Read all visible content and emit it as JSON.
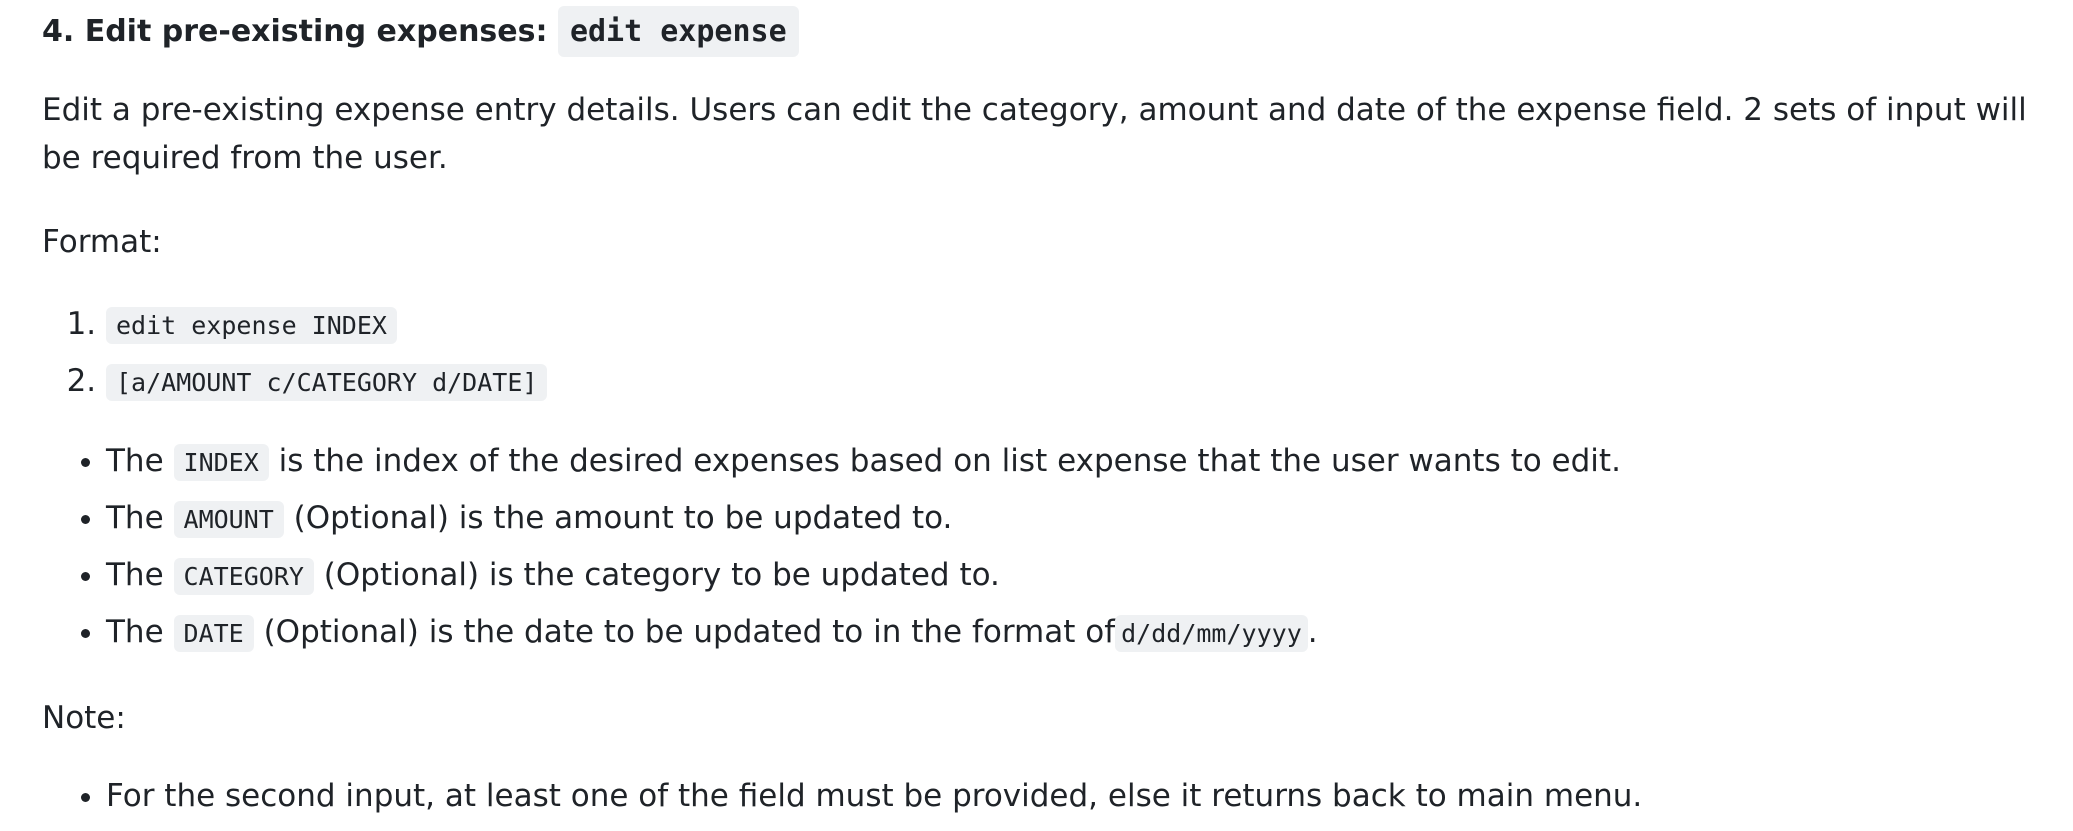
{
  "heading": {
    "prefix": "4. Edit pre-existing expenses: ",
    "command": "edit expense"
  },
  "description": "Edit a pre-existing expense entry details. Users can edit the category, amount and date of the expense field. 2 sets of input will be required from the user.",
  "format_label": "Format:",
  "format_steps": [
    "edit expense INDEX",
    "[a/AMOUNT c/CATEGORY d/DATE]"
  ],
  "params": [
    {
      "pre": "The ",
      "code": "INDEX",
      "post": " is the index of the desired expenses based on list expense that the user wants to edit."
    },
    {
      "pre": "The ",
      "code": "AMOUNT",
      "post": " (Optional) is the amount to be updated to."
    },
    {
      "pre": "The ",
      "code": "CATEGORY",
      "post": " (Optional) is the category to be updated to."
    },
    {
      "pre": "The ",
      "code": "DATE",
      "post": " (Optional) is the date to be updated to in the format of",
      "code2": "d/dd/mm/yyyy",
      "end": "."
    }
  ],
  "note_label": "Note:",
  "notes": [
    "For the second input, at least one of the field must be provided, else it returns back to main menu."
  ]
}
